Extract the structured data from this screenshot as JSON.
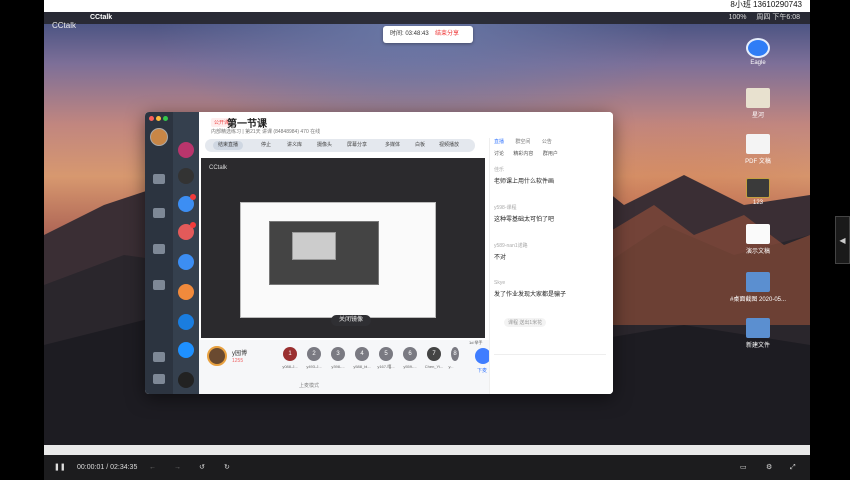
{
  "top_right_text": "8小班 13610290743",
  "menubar": {
    "app": "CCtalk",
    "clock": "周四 下午6:08",
    "battery": "100%"
  },
  "desktop_label": "CCtalk",
  "recording": {
    "time": "时间: 03:48:43",
    "stop": "结束分享"
  },
  "desktop_icons": [
    {
      "label": "Eagle"
    },
    {
      "label": "星河"
    },
    {
      "label": "PDF 文稿"
    },
    {
      "label": "123"
    },
    {
      "label": "演示文稿"
    },
    {
      "label": "#桌面截图 2020-05..."
    },
    {
      "label": "新建文件"
    }
  ],
  "window": {
    "tag": "公开课",
    "title": "第一节课",
    "subtitle": "内部精选练习 | 第21天 讲课 (84848984)  470 在线",
    "toolbar": {
      "share": "结束直播",
      "items": [
        "停止",
        "讲义库",
        "摄像头",
        "屏幕分享",
        "多媒体",
        "白板",
        "视频播放"
      ]
    },
    "screen_label": "CCtalk",
    "close_label": "关闭镜像",
    "host": {
      "name": "y园博",
      "sub": "1255"
    },
    "seats": [
      {
        "num": "1",
        "name": "y088-J..."
      },
      {
        "num": "2",
        "name": "y493-J..."
      },
      {
        "num": "3",
        "name": "y398-..."
      },
      {
        "num": "4",
        "name": "y588_bl..."
      },
      {
        "num": "5",
        "name": "y167-嘻..."
      },
      {
        "num": "6",
        "name": "y559-..."
      },
      {
        "num": "7",
        "name": "Chen_Yi..."
      },
      {
        "num": "8",
        "name": "y..."
      }
    ],
    "host_btn": "下麦",
    "host_btn_top": "1d 举手",
    "bottom_hint": "上麦模式",
    "right_panel": {
      "tabs": [
        "直播",
        "群空间",
        "公告"
      ],
      "subtabs": [
        "讨论",
        "精彩内容",
        "群用户"
      ],
      "messages": [
        {
          "name": "佳乐",
          "text": "老师课上用什么软件画"
        },
        {
          "name": "y598-课程",
          "text": "这种零基础太可怕了吧"
        },
        {
          "name": "y589-nan1诺路",
          "text": "不对"
        },
        {
          "name": "Skye",
          "text": "发了作业发现大家都是骗子"
        }
      ],
      "footer_pill": "课程 送出1米花"
    }
  },
  "player": {
    "time": "00:00:01 / 02:34:35"
  }
}
